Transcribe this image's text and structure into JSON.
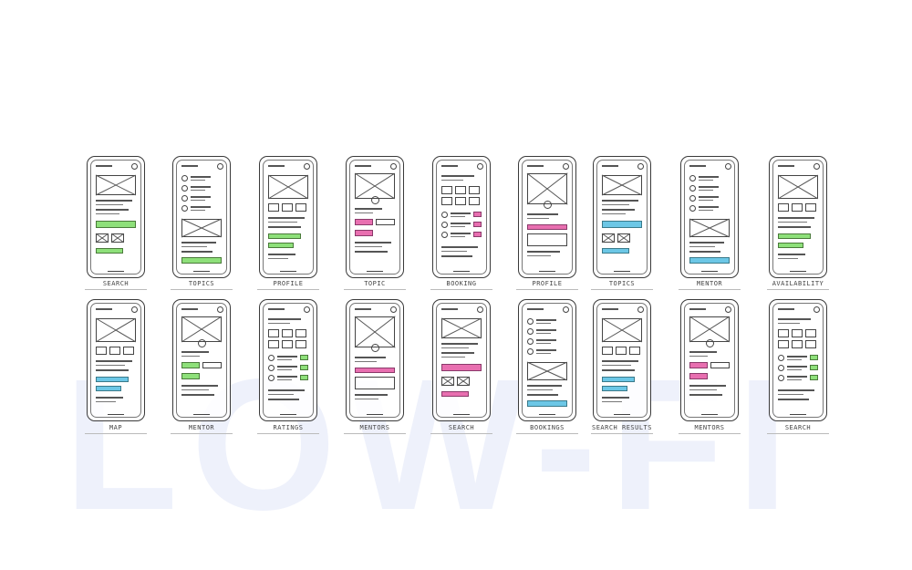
{
  "watermark": "LOW-FI",
  "row1_labels": [
    "SEARCH",
    "TOPICS",
    "PROFILE",
    "TOPIC",
    "BOOKING",
    "PROFILE",
    "TOPICS",
    "MENTOR",
    "AVAILABILITY"
  ],
  "row2_labels": [
    "MAP",
    "MENTOR",
    "RATINGS",
    "MENTORS",
    "SEARCH",
    "BOOKINGS",
    "SEARCH RESULTS",
    "MENTORS",
    "SEARCH"
  ],
  "row1_accents": [
    "green",
    "green",
    "green",
    "pink",
    "pink",
    "pink",
    "blue",
    "blue",
    "green"
  ],
  "row2_accents": [
    "blue",
    "green",
    "green",
    "pink",
    "pink",
    "blue",
    "blue",
    "pink",
    "green"
  ],
  "colors": {
    "green": "#8ee07a",
    "pink": "#e86fb0",
    "blue": "#6cc7e6",
    "sketch": "#3a3a3a",
    "watermark": "#eef1fb"
  }
}
